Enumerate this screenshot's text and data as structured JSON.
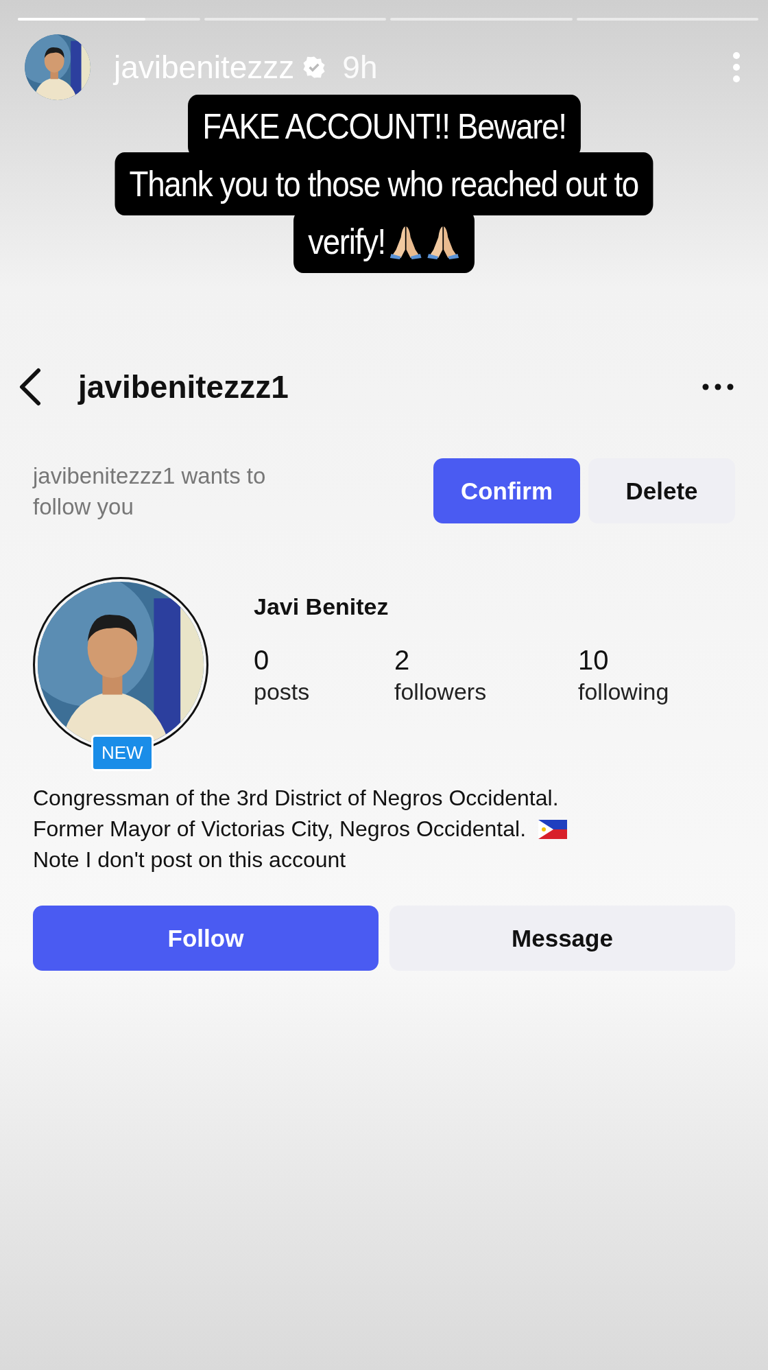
{
  "story": {
    "progress": [
      {
        "kind": "current",
        "level": 0.7
      },
      {
        "kind": "upcoming"
      },
      {
        "kind": "upcoming"
      },
      {
        "kind": "upcoming"
      }
    ],
    "author": {
      "username": "javibenitezzz",
      "verified": true,
      "time": "9h"
    },
    "caption": [
      "FAKE ACCOUNT!! Beware!",
      "Thank you to those who reached out to",
      "verify!"
    ]
  },
  "profile": {
    "username": "javibenitezzz1",
    "request": {
      "text": "javibenitezzz1 wants to follow you",
      "buttons": [
        {
          "label": "Confirm",
          "kind": "primary"
        },
        {
          "label": "Delete",
          "kind": "secondary"
        }
      ]
    },
    "badge": "NEW",
    "name": "Javi Benitez",
    "stats": [
      {
        "value": "0",
        "label": "posts"
      },
      {
        "value": "2",
        "label": "followers"
      },
      {
        "value": "10",
        "label": "following"
      }
    ],
    "bio": [
      "Congressman of the 3rd District of Negros Occidental.",
      "Former Mayor of Victorias City, Negros Occidental.",
      "Note I don't post on this account"
    ],
    "actions": [
      {
        "label": "Follow",
        "kind": "primary"
      },
      {
        "label": "Message",
        "kind": "secondary"
      }
    ]
  }
}
